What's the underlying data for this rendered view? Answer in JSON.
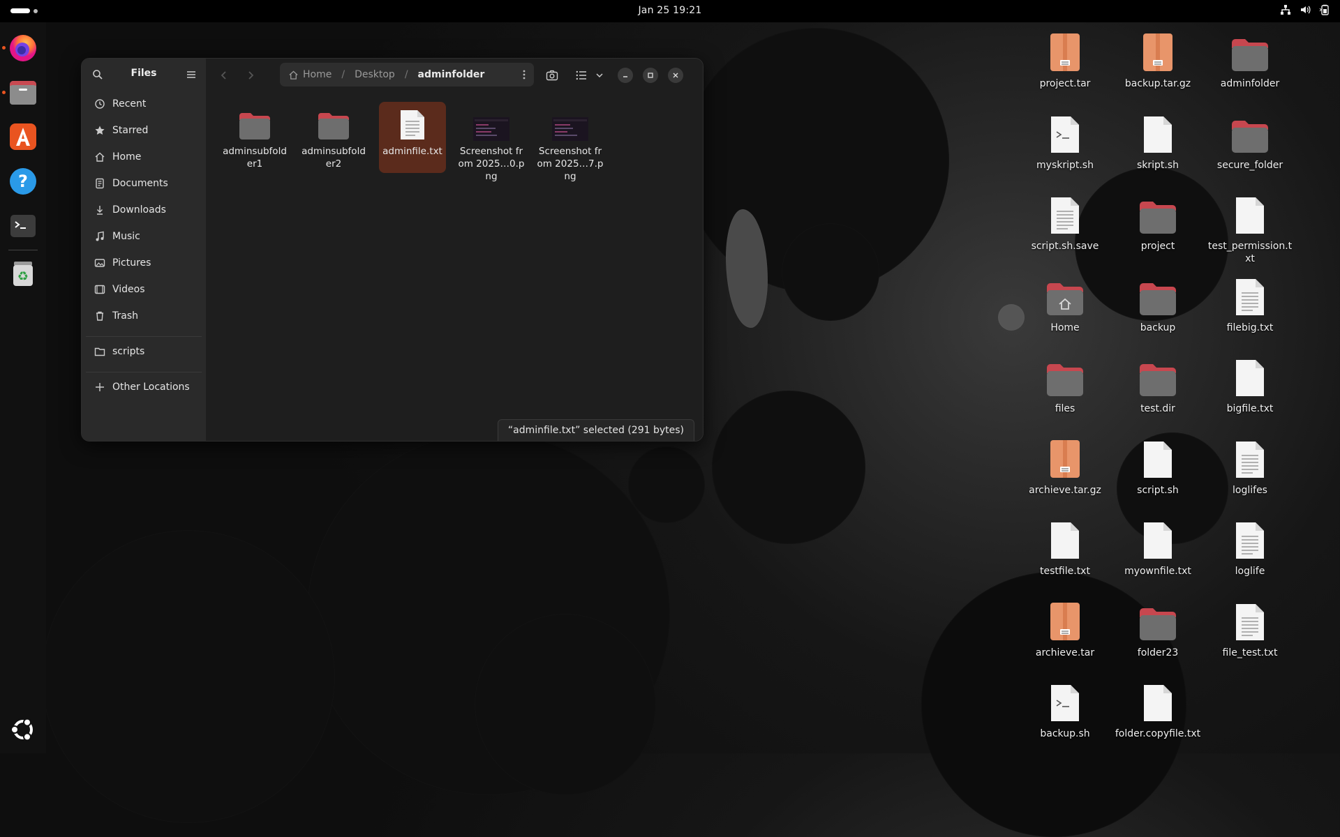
{
  "topbar": {
    "clock": "Jan 25  19:21"
  },
  "dock": {
    "items": [
      {
        "name": "Firefox",
        "icon": "firefox-icon",
        "running": true
      },
      {
        "name": "Files",
        "icon": "files-icon",
        "running": true
      },
      {
        "name": "App Center",
        "icon": "app-center-icon",
        "running": false
      },
      {
        "name": "Help",
        "icon": "help-icon",
        "running": false
      },
      {
        "name": "Terminal",
        "icon": "terminal-icon",
        "running": false
      },
      {
        "name": "Trash",
        "icon": "trash-icon",
        "running": false
      }
    ]
  },
  "files_window": {
    "title": "Files",
    "sidebar": {
      "places": [
        {
          "label": "Recent",
          "icon": "clock-icon"
        },
        {
          "label": "Starred",
          "icon": "star-icon"
        },
        {
          "label": "Home",
          "icon": "home-icon"
        },
        {
          "label": "Documents",
          "icon": "document-icon"
        },
        {
          "label": "Downloads",
          "icon": "download-icon"
        },
        {
          "label": "Music",
          "icon": "music-icon"
        },
        {
          "label": "Pictures",
          "icon": "picture-icon"
        },
        {
          "label": "Videos",
          "icon": "video-icon"
        },
        {
          "label": "Trash",
          "icon": "trash-icon"
        }
      ],
      "bookmarks": [
        {
          "label": "scripts",
          "icon": "folder-icon"
        }
      ],
      "other_locations": "Other Locations"
    },
    "path": [
      "Home",
      "Desktop",
      "adminfolder"
    ],
    "files": [
      {
        "label": "adminsubfolder1",
        "type": "folder",
        "selected": false
      },
      {
        "label": "adminsubfolder2",
        "type": "folder",
        "selected": false
      },
      {
        "label": "adminfile.txt",
        "type": "text",
        "selected": true
      },
      {
        "label": "Screenshot from 2025…0.png",
        "type": "image",
        "selected": false
      },
      {
        "label": "Screenshot from 2025…7.png",
        "type": "image",
        "selected": false
      }
    ],
    "status": "“adminfile.txt” selected  (291 bytes)"
  },
  "desktop": {
    "icons": [
      {
        "label": "project.tar",
        "type": "archive"
      },
      {
        "label": "backup.tar.gz",
        "type": "archive"
      },
      {
        "label": "adminfolder",
        "type": "folder"
      },
      {
        "label": "myskript.sh",
        "type": "script"
      },
      {
        "label": "skript.sh",
        "type": "blank"
      },
      {
        "label": "secure_folder",
        "type": "folder"
      },
      {
        "label": "script.sh.save",
        "type": "text"
      },
      {
        "label": "project",
        "type": "folder"
      },
      {
        "label": "test_permission.txt",
        "type": "blank"
      },
      {
        "label": "Home",
        "type": "home"
      },
      {
        "label": "backup",
        "type": "folder"
      },
      {
        "label": "filebig.txt",
        "type": "text"
      },
      {
        "label": "files",
        "type": "folder"
      },
      {
        "label": "test.dir",
        "type": "folder"
      },
      {
        "label": "bigfile.txt",
        "type": "blank"
      },
      {
        "label": "archieve.tar.gz",
        "type": "archive"
      },
      {
        "label": "script.sh",
        "type": "blank"
      },
      {
        "label": "loglifes",
        "type": "text"
      },
      {
        "label": "testfile.txt",
        "type": "blank"
      },
      {
        "label": "myownfile.txt",
        "type": "blank"
      },
      {
        "label": "loglife",
        "type": "text"
      },
      {
        "label": "archieve.tar",
        "type": "archive"
      },
      {
        "label": "folder23",
        "type": "folder"
      },
      {
        "label": "file_test.txt",
        "type": "text"
      },
      {
        "label": "backup.sh",
        "type": "script"
      },
      {
        "label": "folder.copyfile.txt",
        "type": "blank"
      }
    ]
  },
  "colors": {
    "accent": "#e95420",
    "selection": "#5b2b1c",
    "folder_tab": "#c7474f",
    "archive": "#e8956a"
  }
}
